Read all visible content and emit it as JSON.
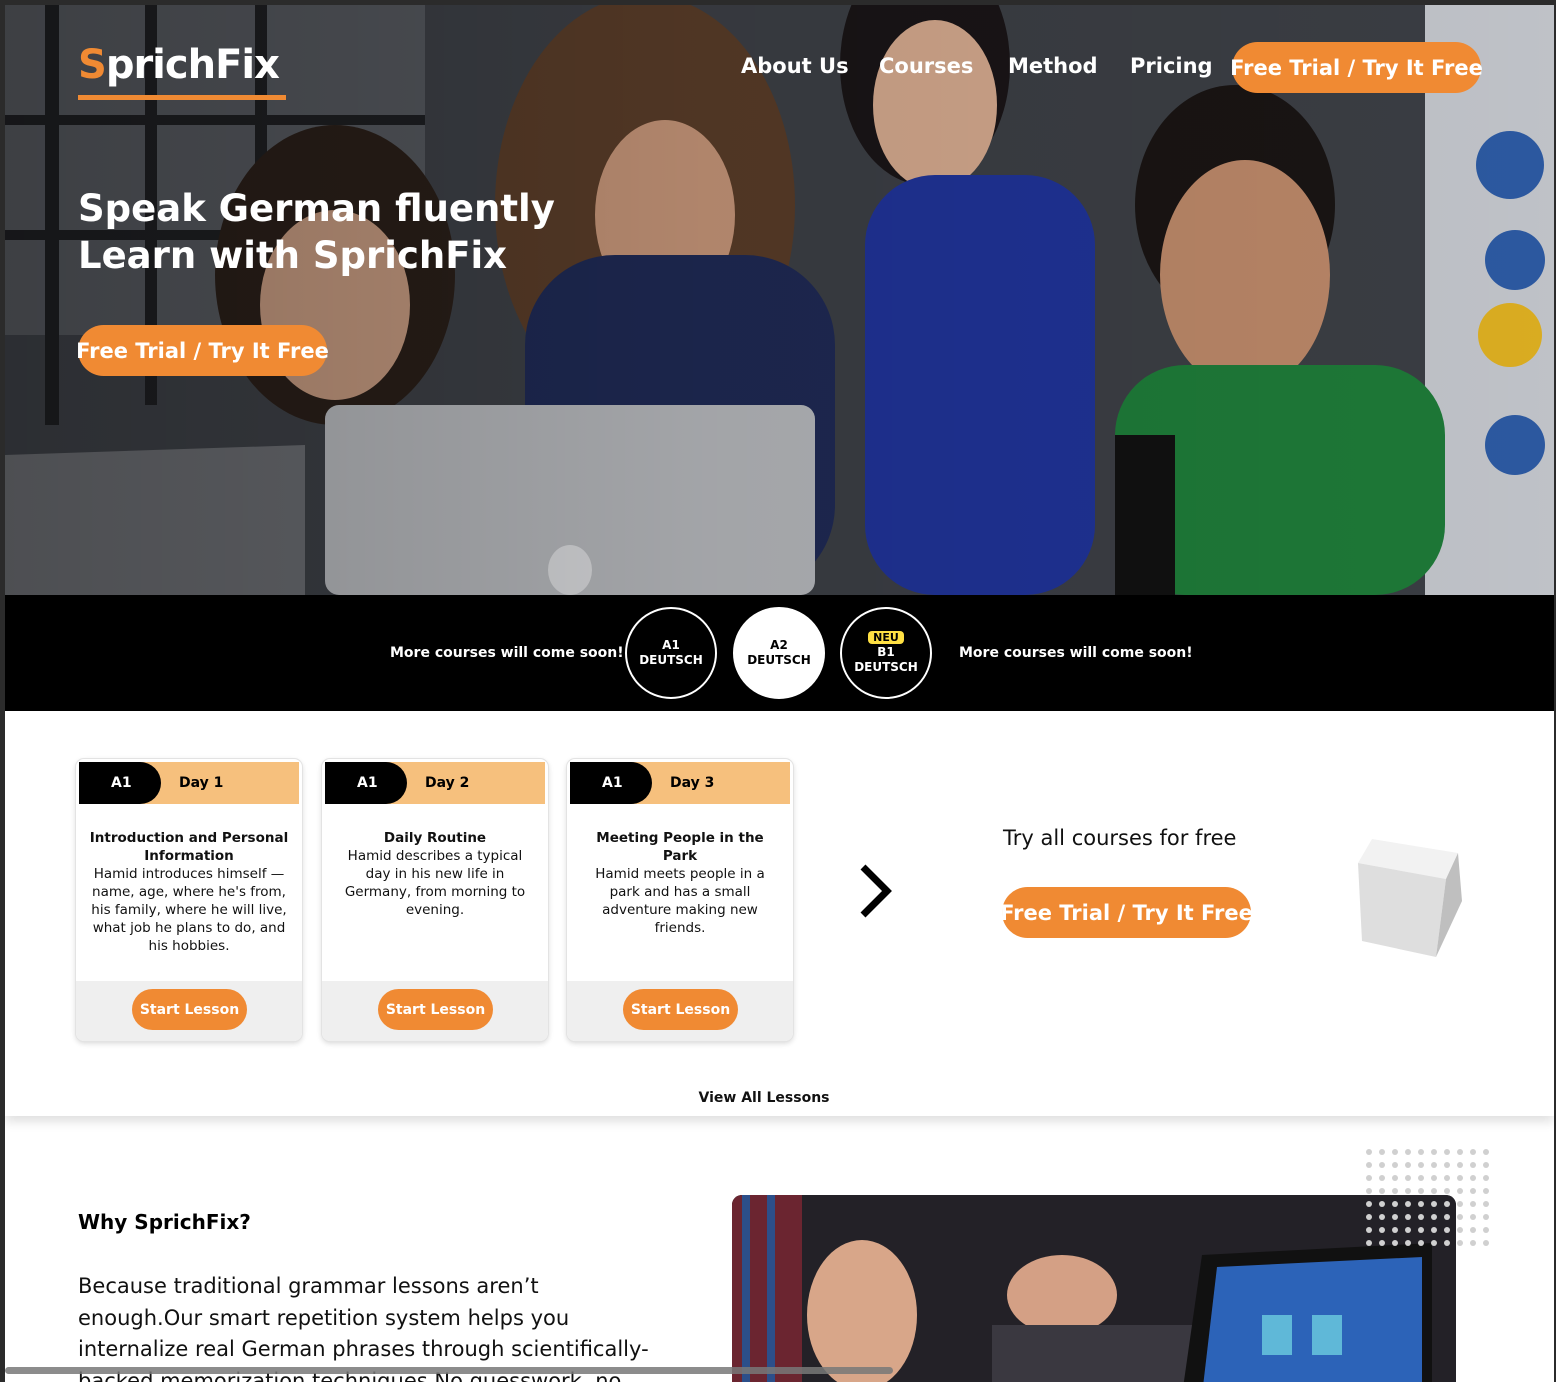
{
  "brand": {
    "logo_first": "S",
    "logo_rest": "prichFix",
    "accent": "#f08a33"
  },
  "nav": {
    "links": [
      "About Us",
      "Courses",
      "Method",
      "Pricing"
    ],
    "cta": "Free Trial / Try It Free"
  },
  "hero": {
    "title_line1": "Speak German fluently",
    "title_line2": "Learn with SprichFix",
    "cta": "Free Trial / Try It Free"
  },
  "levels": {
    "soon_left": "More courses will come soon!",
    "soon_right": "More courses will come soon!",
    "items": [
      {
        "code": "A1",
        "label": "DEUTSCH",
        "badge": "",
        "active": false
      },
      {
        "code": "A2",
        "label": "DEUTSCH",
        "badge": "",
        "active": true
      },
      {
        "code": "B1",
        "label": "DEUTSCH",
        "badge": "NEU",
        "active": false
      }
    ]
  },
  "lessons": {
    "cards": [
      {
        "level": "A1",
        "day": "Day 1",
        "title": "Introduction and Personal Information",
        "desc": "Hamid introduces himself — name, age, where he's from, his family, where he will live, what job he plans to do, and his hobbies.",
        "button": "Start Lesson"
      },
      {
        "level": "A1",
        "day": "Day 2",
        "title": "Daily Routine",
        "desc": "Hamid describes a typical day in his new life in Germany, from morning to evening.",
        "button": "Start Lesson"
      },
      {
        "level": "A1",
        "day": "Day 3",
        "title": "Meeting People in the Park",
        "desc": "Hamid meets people in a park and has a small adventure making new friends.",
        "button": "Start Lesson"
      }
    ],
    "try_title": "Try all courses for free",
    "try_cta": "Free Trial / Try It Free",
    "view_all": "View All Lessons"
  },
  "why": {
    "title": "Why SprichFix?",
    "text": "Because traditional grammar lessons aren’t enough.Our smart repetition system helps you internalize real German phrases through scientifically-backed memorization techniques.No guesswork, no clutter —"
  }
}
